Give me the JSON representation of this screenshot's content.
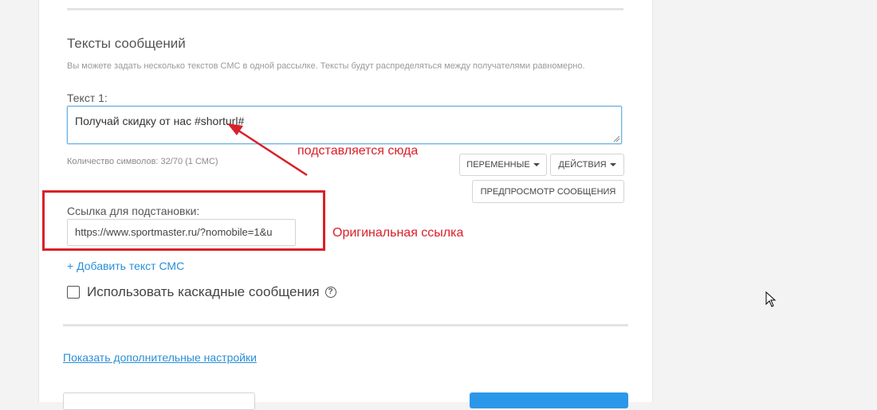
{
  "messages_section": {
    "title": "Тексты сообщений",
    "description": "Вы можете задать несколько текстов СМС в одной рассылке. Тексты будут распределяться между получателями равномерно.",
    "text_label": "Текст 1:",
    "text_value": "Получай скидку от нас #shorturl#",
    "char_count": "Количество символов: 32/70 (1 СМС)",
    "variables_button": "ПЕРЕМЕННЫЕ",
    "actions_button": "ДЕЙСТВИЯ",
    "preview_button": "ПРЕДПРОСМОТР СООБЩЕНИЯ",
    "link_label": "Ссылка для подстановки:",
    "link_value": "https://www.sportmaster.ru/?nomobile=1&u",
    "add_text_link": "+ Добавить текст СМС",
    "cascade_label": "Использовать каскадные сообщения",
    "help_glyph": "?"
  },
  "more_settings_link": "Показать дополнительные настройки",
  "annotations": {
    "substitute_here": "подставляется сюда",
    "original_link": "Оригинальная ссылка",
    "color": "#d9202a"
  },
  "accent_color": "#2a8fd8",
  "primary_button_color": "#2b97e9"
}
